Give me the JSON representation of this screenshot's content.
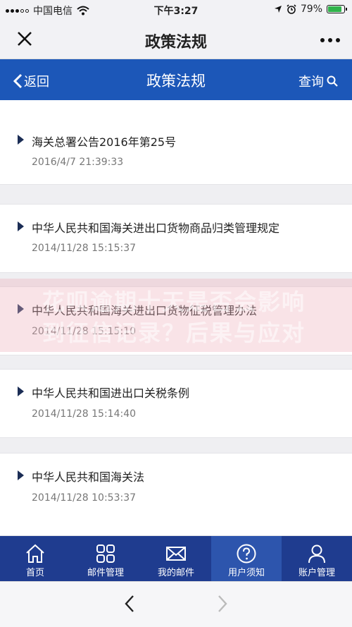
{
  "status_bar": {
    "carrier": "中国电信",
    "time": "下午3:27",
    "battery": "79%",
    "battery_level": 0.79
  },
  "wechat_bar": {
    "title": "政策法规"
  },
  "nav": {
    "back_label": "返回",
    "title": "政策法规",
    "query_label": "查询"
  },
  "list": [
    {
      "title": "海关总署公告2016年第25号",
      "time": "2016/4/7 21:39:33"
    },
    {
      "title": "中华人民共和国海关进出口货物商品归类管理规定",
      "time": "2014/11/28 15:15:37"
    },
    {
      "title": "中华人民共和国海关进出口货物征税管理办法",
      "time": "2014/11/28 15:15:10"
    },
    {
      "title": "中华人民共和国进出口关税条例",
      "time": "2014/11/28 15:14:40"
    },
    {
      "title": "中华人民共和国海关法",
      "time": "2014/11/28 10:53:37"
    }
  ],
  "overlay": {
    "line1": "花呗逾期十天是否会影响",
    "line2": "到征信记录？后果与应对"
  },
  "tabs": [
    {
      "label": "首页",
      "icon": "home-icon"
    },
    {
      "label": "邮件管理",
      "icon": "grid-icon"
    },
    {
      "label": "我的邮件",
      "icon": "mail-icon"
    },
    {
      "label": "用户须知",
      "icon": "help-icon",
      "active": true
    },
    {
      "label": "账户管理",
      "icon": "user-icon"
    }
  ],
  "colors": {
    "nav_blue": "#1c57b8",
    "tab_blue": "#1f3c8f",
    "tab_active": "#2d55ad"
  }
}
